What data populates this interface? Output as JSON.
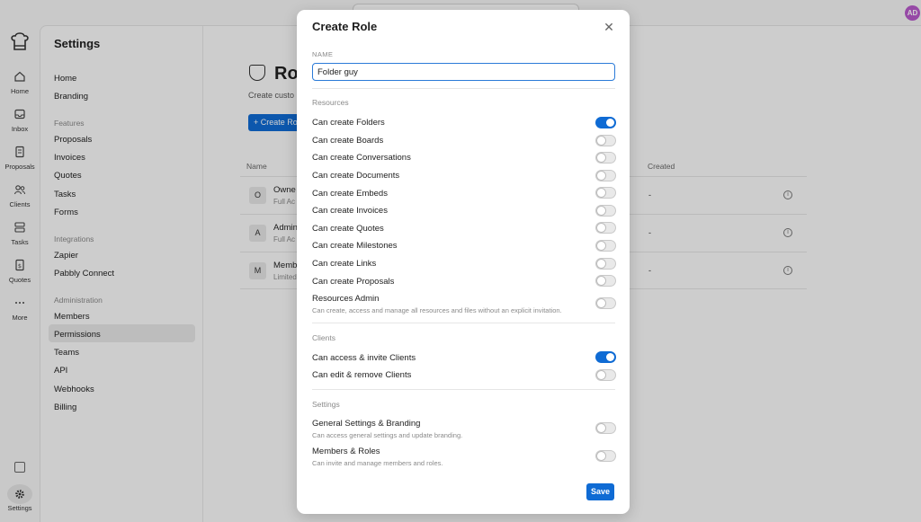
{
  "topbar": {
    "avatar_initials": "AD"
  },
  "rail": {
    "items": [
      {
        "label": "Home",
        "icon": "home-icon"
      },
      {
        "label": "Inbox",
        "icon": "inbox-icon"
      },
      {
        "label": "Proposals",
        "icon": "proposals-icon"
      },
      {
        "label": "Clients",
        "icon": "clients-icon"
      },
      {
        "label": "Tasks",
        "icon": "tasks-icon"
      },
      {
        "label": "Quotes",
        "icon": "quotes-icon"
      },
      {
        "label": "More",
        "icon": "more-icon"
      }
    ],
    "settings_label": "Settings"
  },
  "sidebar": {
    "title": "Settings",
    "home": "Home",
    "branding": "Branding",
    "features_group": "Features",
    "proposals": "Proposals",
    "invoices": "Invoices",
    "quotes": "Quotes",
    "tasks": "Tasks",
    "forms": "Forms",
    "integrations_group": "Integrations",
    "zapier": "Zapier",
    "pabbly": "Pabbly Connect",
    "administration_group": "Administration",
    "members": "Members",
    "permissions": "Permissions",
    "teams": "Teams",
    "api": "API",
    "webhooks": "Webhooks",
    "billing": "Billing"
  },
  "main": {
    "title": "Ro",
    "subtitle": "Create custo",
    "create_button": "+ Create Ro",
    "col_name": "Name",
    "col_created": "Created",
    "rows": [
      {
        "initial": "O",
        "name": "Owne",
        "desc": "Full Ac",
        "created": "-"
      },
      {
        "initial": "A",
        "name": "Admin",
        "desc": "Full Ac",
        "created": "-"
      },
      {
        "initial": "M",
        "name": "Memb",
        "desc": "Limited",
        "created": "-"
      }
    ]
  },
  "modal": {
    "title": "Create Role",
    "name_label": "NAME",
    "name_value": "Folder guy",
    "resources_section": "Resources",
    "resources": [
      {
        "label": "Can create Folders",
        "on": true
      },
      {
        "label": "Can create Boards",
        "on": false
      },
      {
        "label": "Can create Conversations",
        "on": false
      },
      {
        "label": "Can create Documents",
        "on": false
      },
      {
        "label": "Can create Embeds",
        "on": false
      },
      {
        "label": "Can create Invoices",
        "on": false
      },
      {
        "label": "Can create Quotes",
        "on": false
      },
      {
        "label": "Can create Milestones",
        "on": false
      },
      {
        "label": "Can create Links",
        "on": false
      },
      {
        "label": "Can create Proposals",
        "on": false
      }
    ],
    "resources_admin": {
      "label": "Resources Admin",
      "desc": "Can create, access and manage all resources and files without an explicit invitation.",
      "on": false
    },
    "clients_section": "Clients",
    "clients": [
      {
        "label": "Can access & invite Clients",
        "on": true
      },
      {
        "label": "Can edit & remove Clients",
        "on": false
      }
    ],
    "settings_section": "Settings",
    "settings": [
      {
        "label": "General Settings & Branding",
        "desc": "Can access general settings and update branding.",
        "on": false
      },
      {
        "label": "Members & Roles",
        "desc": "Can invite and manage members and roles.",
        "on": false
      }
    ],
    "save_label": "Save"
  },
  "colors": {
    "accent": "#0f6bd4",
    "avatar": "#b85acb"
  }
}
